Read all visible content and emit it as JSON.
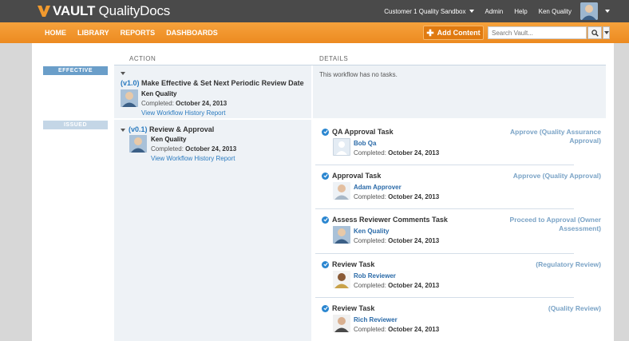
{
  "header": {
    "logo_bold": "VAULT",
    "logo_rest": " QualityDocs",
    "sandbox": "Customer 1 Quality Sandbox",
    "admin": "Admin",
    "help": "Help",
    "user": "Ken Quality"
  },
  "nav": {
    "items": [
      "HOME",
      "LIBRARY",
      "REPORTS",
      "DASHBOARDS"
    ],
    "add_content": "Add Content",
    "search_placeholder": "Search Vault..."
  },
  "columns": {
    "action": "ACTION",
    "details": "DETAILS"
  },
  "effective": {
    "badge": "EFFECTIVE",
    "version": "(v1.0)",
    "title": " Make Effective & Set Next Periodic Review Date",
    "user": "Ken Quality",
    "completed_label": "Completed:",
    "completed_date": "October 24, 2013",
    "history_link": "View Workflow History Report",
    "details_text": "This workflow has no tasks."
  },
  "issued": {
    "badge": "ISSUED",
    "version": "(v0.1)",
    "title": " Review & Approval",
    "user": "Ken Quality",
    "completed_label": "Completed:",
    "completed_date": "October 24, 2013",
    "history_link": "View Workflow History Report",
    "tasks": [
      {
        "title": "QA Approval Task",
        "user": "Bob Qa",
        "completed_label": "Completed:",
        "completed_date": "October 24, 2013",
        "verdict_1": "Approve (Quality Assurance",
        "verdict_2": "Approval)"
      },
      {
        "title": "Approval Task",
        "user": "Adam Approver",
        "completed_label": "Completed:",
        "completed_date": "October 24, 2013",
        "verdict_1": "Approve (Quality Approval)",
        "verdict_2": ""
      },
      {
        "title": "Assess Reviewer Comments Task",
        "user": "Ken Quality",
        "completed_label": "Completed:",
        "completed_date": "October 24, 2013",
        "verdict_1": "Proceed to Approval (Owner",
        "verdict_2": "Assessment)"
      },
      {
        "title": "Review Task",
        "user": "Rob Reviewer",
        "completed_label": "Completed:",
        "completed_date": "October 24, 2013",
        "verdict_1": "(Regulatory Review)",
        "verdict_2": ""
      },
      {
        "title": "Review Task",
        "user": "Rich Reviewer",
        "completed_label": "Completed:",
        "completed_date": "October 24, 2013",
        "verdict_1": "(Quality Review)",
        "verdict_2": ""
      }
    ]
  },
  "colors": {
    "topbar": "#4a4a4a",
    "orange": "#ec8a20",
    "accent_blue": "#2a7abf",
    "badge_blue": "#6a9ec9"
  }
}
